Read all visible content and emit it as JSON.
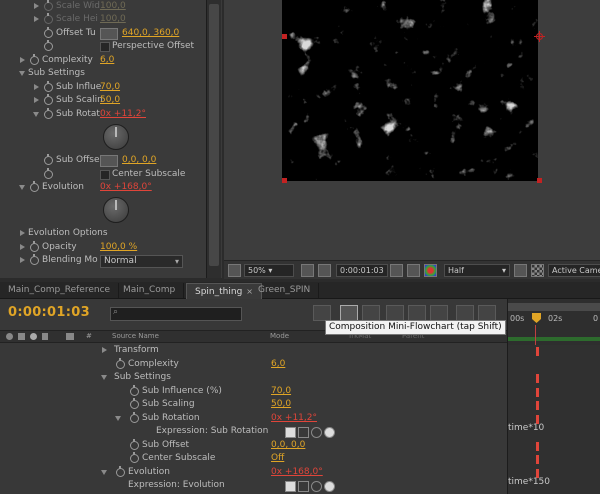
{
  "effect_controls": {
    "scale_width": {
      "label": "Scale Wid",
      "value": "100,0"
    },
    "scale_height": {
      "label": "Scale Hei",
      "value": "100,0"
    },
    "offset_turbulence": {
      "label": "Offset Tu",
      "value": "640,0, 360,0"
    },
    "perspective_offset": {
      "label": "Perspective Offset"
    },
    "complexity": {
      "label": "Complexity",
      "value": "6,0"
    },
    "sub_settings": {
      "label": "Sub Settings"
    },
    "sub_influence": {
      "label": "Sub Influe",
      "value": "70,0"
    },
    "sub_scaling": {
      "label": "Sub Scalin",
      "value": "50,0"
    },
    "sub_rotation": {
      "label": "Sub Rotat",
      "value": "0x +11,2°"
    },
    "sub_offset": {
      "label": "Sub Offse",
      "value": "0,0, 0,0"
    },
    "center_subscale": {
      "label": "Center Subscale"
    },
    "evolution": {
      "label": "Evolution",
      "value": "0x +168,0°"
    },
    "evolution_options": {
      "label": "Evolution Options"
    },
    "opacity": {
      "label": "Opacity",
      "value": "100,0 %"
    },
    "blending_mode": {
      "label": "Blending Mo",
      "value": "Normal"
    }
  },
  "viewer": {
    "zoom": "50%",
    "timecode": "0:00:01:03",
    "resolution": "Half",
    "camera": "Active Camera"
  },
  "tabs": [
    {
      "label": "Main_Comp_Reference"
    },
    {
      "label": "Main_Comp"
    },
    {
      "label": "Spin_thing",
      "close": "×"
    },
    {
      "label": "Green_SPIN"
    }
  ],
  "timeline": {
    "timecode": "0:00:01:03",
    "tooltip": "Composition Mini-Flowchart (tap Shift)",
    "columns": {
      "hash": "#",
      "source_name": "Source Name",
      "mode": "Mode",
      "trkmat": "TrkMat",
      "parent": "Parent"
    },
    "ruler": {
      "start": "00s",
      "mark": "02s",
      "end": "0"
    },
    "rows": {
      "transform": "Transform",
      "complexity": {
        "label": "Complexity",
        "value": "6,0"
      },
      "sub_settings": "Sub Settings",
      "sub_influence": {
        "label": "Sub Influence (%)",
        "value": "70,0"
      },
      "sub_scaling": {
        "label": "Sub Scaling",
        "value": "50,0"
      },
      "sub_rotation": {
        "label": "Sub Rotation",
        "value": "0x +11,2°"
      },
      "expr_sub_rotation": {
        "label": "Expression: Sub Rotation",
        "code": "time*10"
      },
      "sub_offset": {
        "label": "Sub Offset",
        "value": "0,0, 0,0"
      },
      "center_subscale": {
        "label": "Center Subscale",
        "value": "Off"
      },
      "evolution": {
        "label": "Evolution",
        "value": "0x +168,0°"
      },
      "expr_evolution": {
        "label": "Expression: Evolution",
        "code": "time*150"
      }
    }
  },
  "colors": {
    "accent": "#e0a526",
    "keyframe_red": "#e0453a",
    "handle_red": "#c32222",
    "panel": "#3a3a3a"
  }
}
